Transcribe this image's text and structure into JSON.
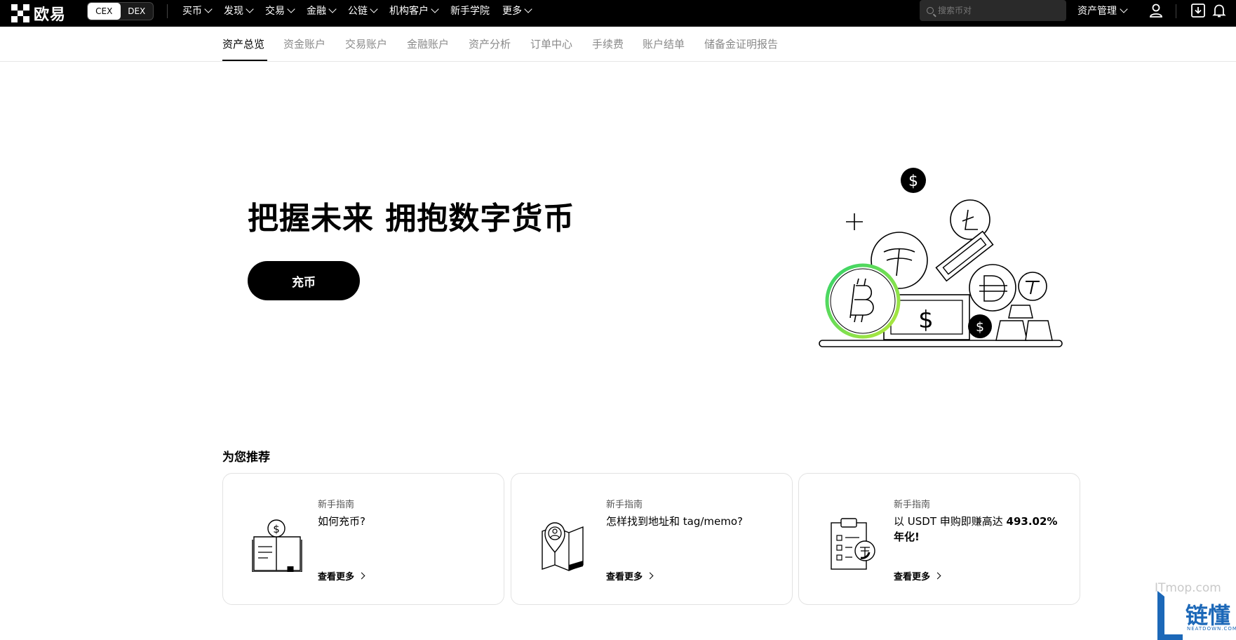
{
  "topbar": {
    "logo_text": "欧易",
    "mode_toggle": {
      "cex": "CEX",
      "dex": "DEX",
      "active": "CEX"
    },
    "nav": [
      {
        "label": "买币",
        "has_dropdown": true
      },
      {
        "label": "发现",
        "has_dropdown": true
      },
      {
        "label": "交易",
        "has_dropdown": true
      },
      {
        "label": "金融",
        "has_dropdown": true
      },
      {
        "label": "公链",
        "has_dropdown": true
      },
      {
        "label": "机构客户",
        "has_dropdown": true
      },
      {
        "label": "新手学院",
        "has_dropdown": false
      },
      {
        "label": "更多",
        "has_dropdown": true
      }
    ],
    "search_placeholder": "搜索币对",
    "asset_management": "资产管理",
    "icons": [
      "user-icon",
      "download-icon",
      "bell-icon"
    ]
  },
  "subtabs": {
    "active": "资产总览",
    "items": [
      "资产总览",
      "资金账户",
      "交易账户",
      "金融账户",
      "资产分析",
      "订单中心",
      "手续费",
      "账户结单",
      "储备金证明报告"
    ]
  },
  "hero": {
    "title": "把握未来 拥抱数字货币",
    "button": "充币"
  },
  "recommend": {
    "title": "为您推荐",
    "cards": [
      {
        "tag": "新手指南",
        "title": "如何充币?",
        "more": "查看更多",
        "icon": "deposit-guide-icon"
      },
      {
        "tag": "新手指南",
        "title": "怎样找到地址和 tag/memo?",
        "more": "查看更多",
        "icon": "map-location-icon"
      },
      {
        "tag": "新手指南",
        "title_prefix": "以 USDT 申购即赚高达 ",
        "title_highlight": "493.02% 年化!",
        "more": "查看更多",
        "icon": "clipboard-tether-icon"
      }
    ]
  },
  "watermark": {
    "itmop": "ITmop.com",
    "brand": "链懂",
    "brand_sub": "NEATDOWN.COM"
  },
  "colors": {
    "topbar_bg": "#000000",
    "accent_ring_green": "#5ad84a",
    "watermark_blue": "#1c68b8"
  }
}
